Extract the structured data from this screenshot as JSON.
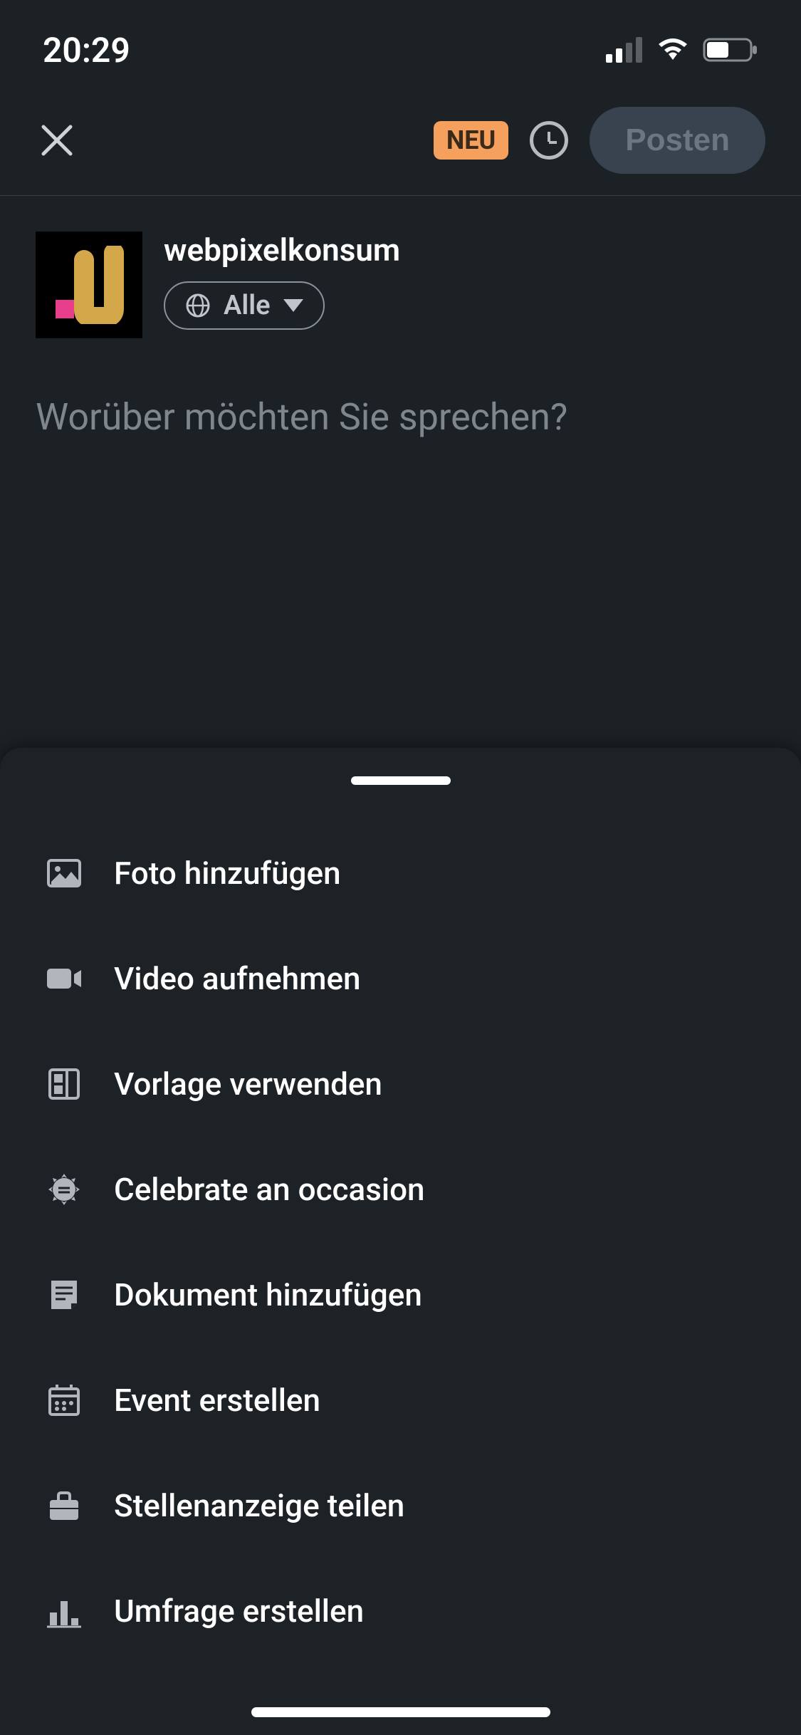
{
  "status": {
    "time": "20:29"
  },
  "header": {
    "neu_label": "NEU",
    "post_label": "Posten"
  },
  "user": {
    "username": "webpixelkonsum",
    "audience_label": "Alle"
  },
  "composer": {
    "placeholder": "Worüber möchten Sie sprechen?"
  },
  "sheet": {
    "options": [
      {
        "label": "Foto hinzufügen",
        "icon": "photo"
      },
      {
        "label": "Video aufnehmen",
        "icon": "video"
      },
      {
        "label": "Vorlage verwenden",
        "icon": "template"
      },
      {
        "label": "Celebrate an occasion",
        "icon": "celebrate"
      },
      {
        "label": "Dokument hinzufügen",
        "icon": "document"
      },
      {
        "label": "Event erstellen",
        "icon": "event"
      },
      {
        "label": "Stellenanzeige teilen",
        "icon": "job"
      },
      {
        "label": "Umfrage erstellen",
        "icon": "poll"
      }
    ]
  }
}
